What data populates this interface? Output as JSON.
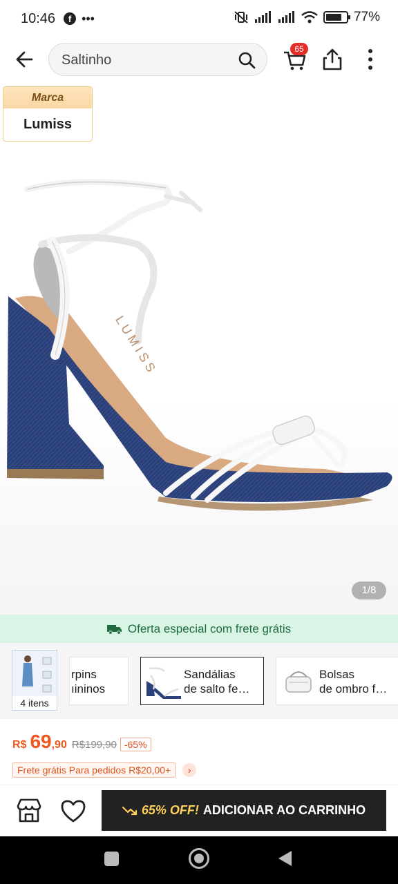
{
  "status_bar": {
    "time": "10:46",
    "battery": "77%",
    "battery_level": 0.77
  },
  "search": {
    "query": "Saltinho"
  },
  "cart": {
    "count": "65"
  },
  "brand": {
    "label": "Marca",
    "name": "Lumiss"
  },
  "product_image": {
    "counter": "1/8",
    "logo_text": "LUMISS"
  },
  "shipping_banner": {
    "text": "Oferta especial com frete grátis"
  },
  "related": {
    "outfit_count": "4 itens",
    "items": [
      {
        "line1": "rpins",
        "line2": "ıininos"
      },
      {
        "line1": "Sandálias",
        "line2": "de salto fe…"
      },
      {
        "line1": "Bolsas",
        "line2": "de ombro f…"
      }
    ]
  },
  "price": {
    "currency": "R$",
    "integer": "69",
    "decimal": ",90",
    "original": "R$199,90",
    "discount": "-65%",
    "free_shipping": "Frete grátis Para pedidos R$20,00+"
  },
  "action_bar": {
    "cta_off": "65% OFF!",
    "cta_label": "ADICIONAR AO CARRINHO"
  },
  "colors": {
    "accent": "#f0561d",
    "cta": "#222222",
    "banner_bg": "#d9f5e6",
    "badge": "#e52d27"
  }
}
